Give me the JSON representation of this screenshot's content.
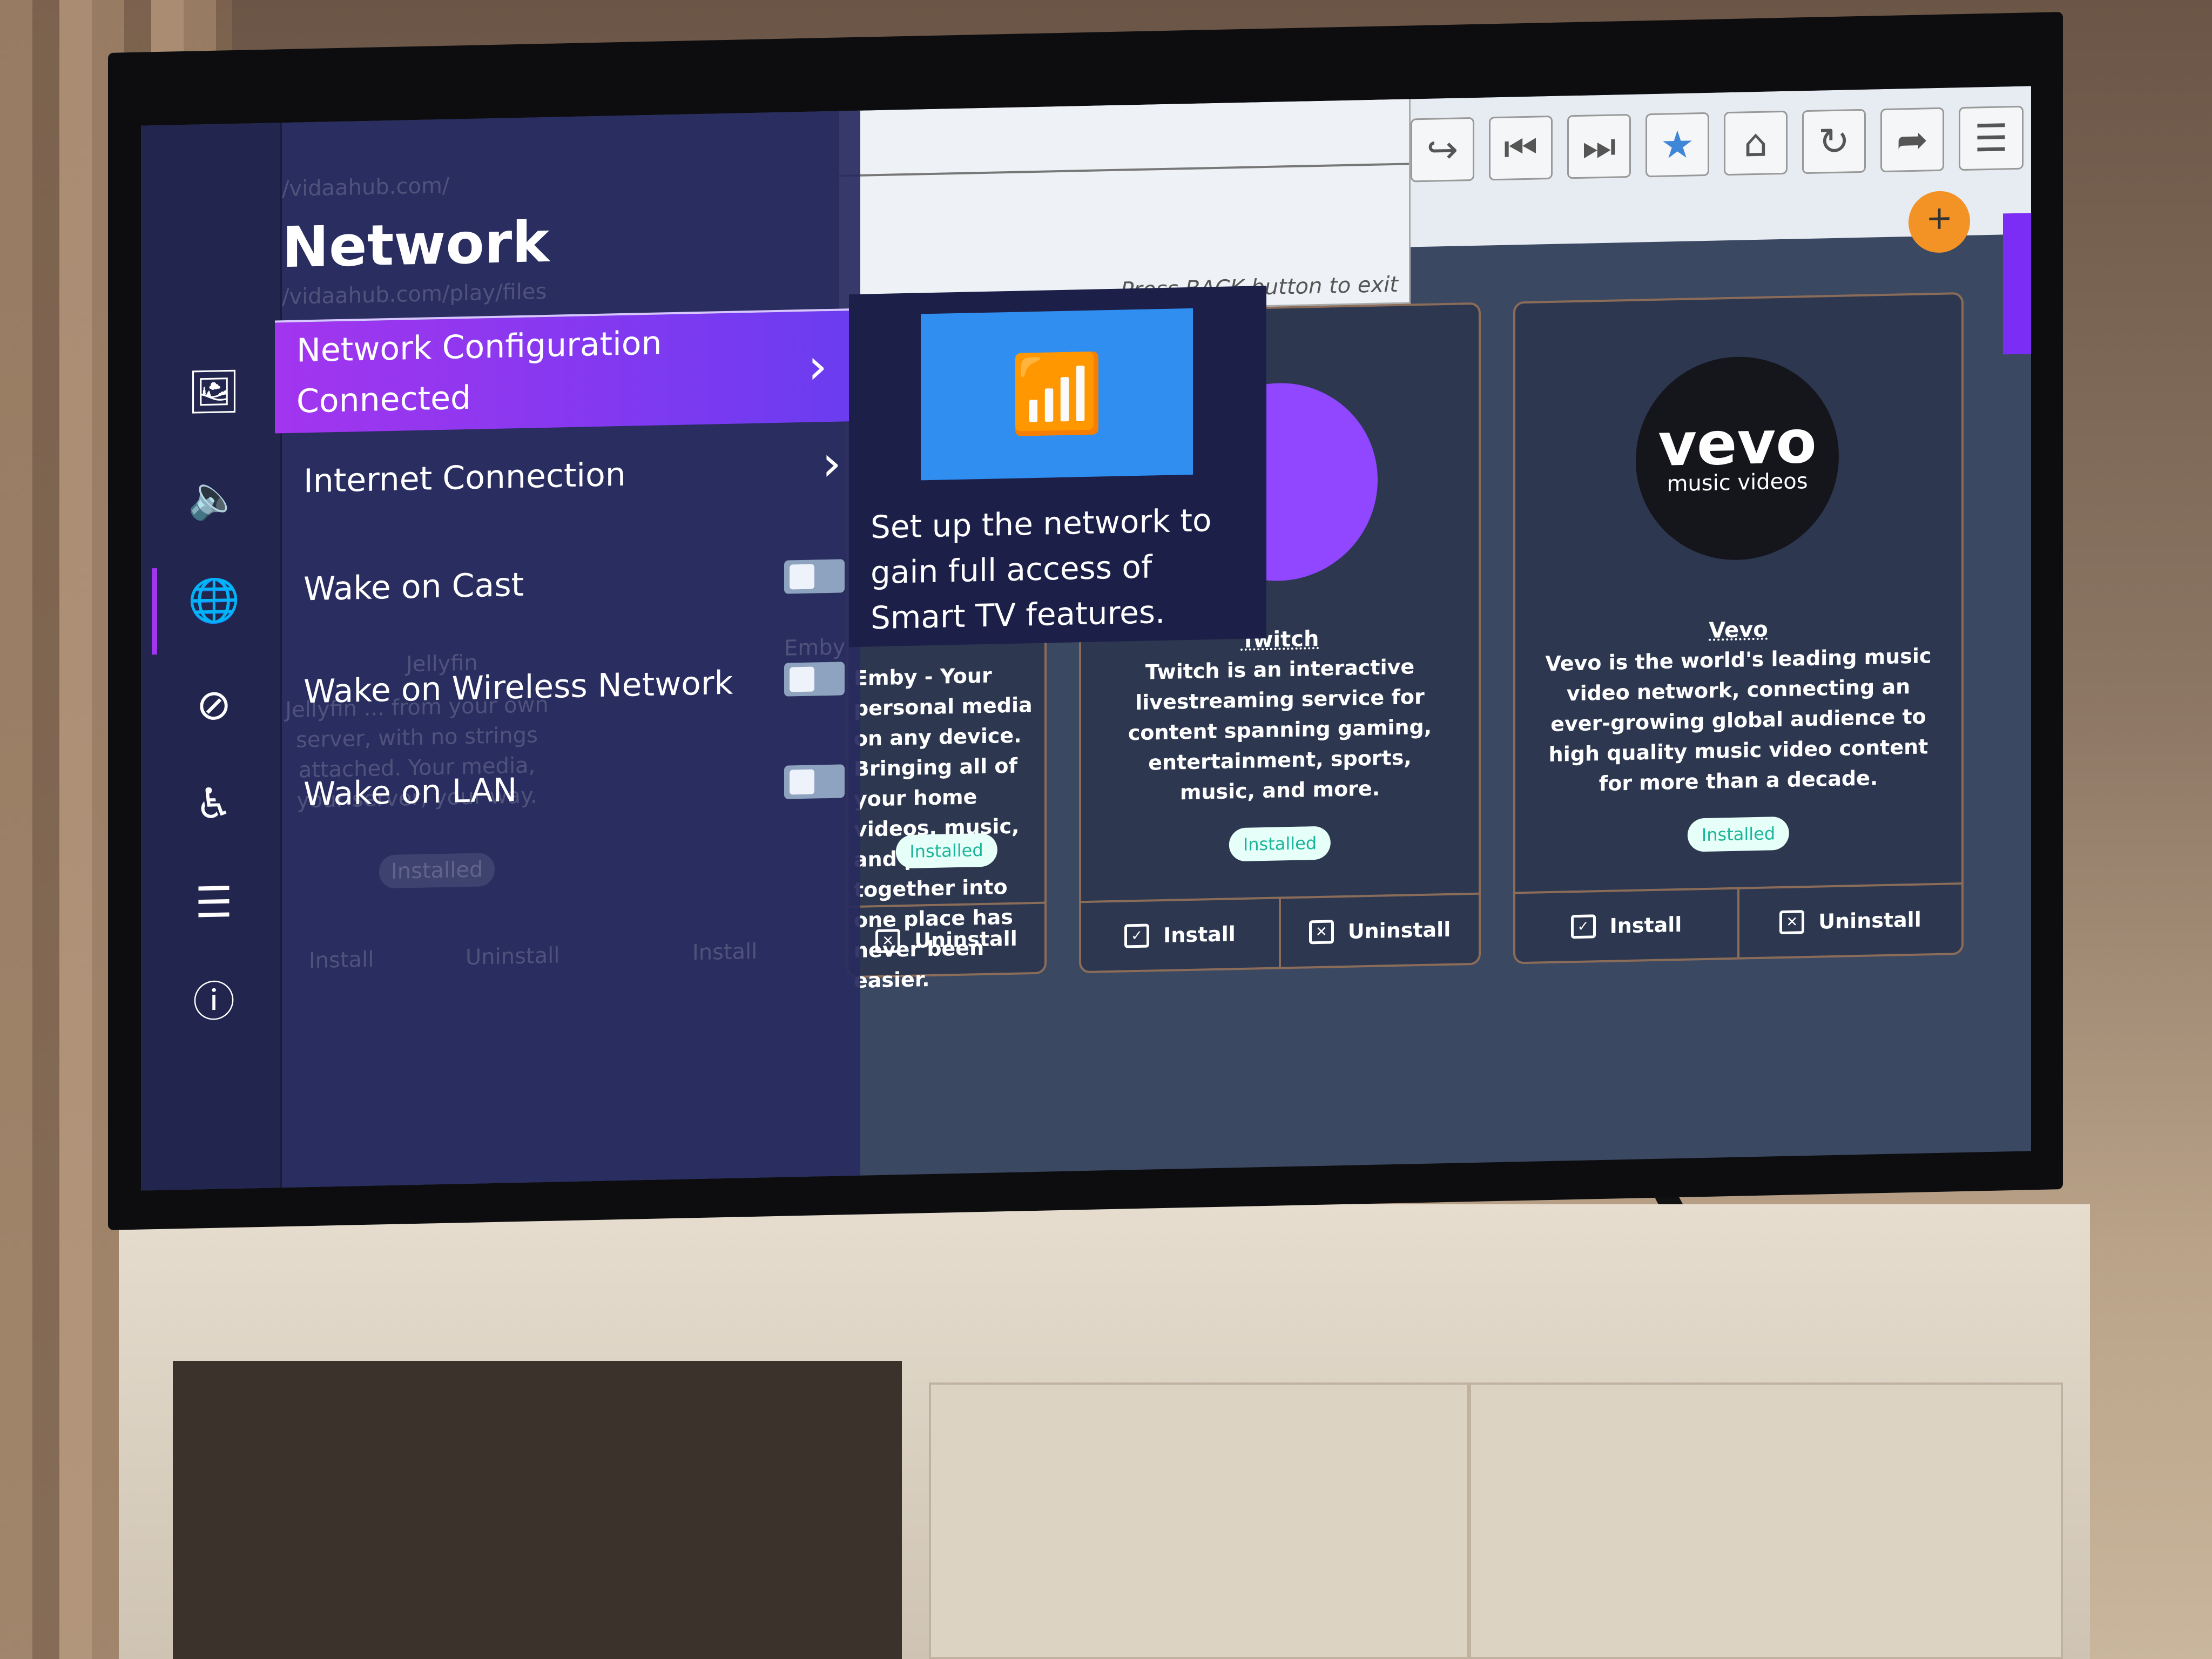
{
  "browser": {
    "toolbar_icons": [
      "redo-icon",
      "skip-back-icon",
      "skip-forward-icon",
      "star-icon",
      "home-icon",
      "reload-icon",
      "share-icon",
      "menu-icon"
    ],
    "star_color": "#3d86d8",
    "exit_hint": "Press BACK button to exit"
  },
  "background_page": {
    "url_1": "/vidaahub.com/",
    "url_2": "/vidaahub.com/play/files",
    "jellyfin": {
      "title": "Jellyfin",
      "desc": "Jellyfin ... from your own server, with no strings attached. Your media, your server, your way.",
      "status": "Installed"
    },
    "emby": {
      "title": "Emby",
      "desc": "Emby - Your personal media on any device. Bringing all of your home videos, music, and photos together into one place has never been easier.",
      "status": "Installed"
    },
    "twitch": {
      "title": "Twitch",
      "desc": "Twitch is an interactive livestreaming service for content spanning gaming, entertainment, sports, music, and more.",
      "status": "Installed"
    },
    "vevo": {
      "title": "Vevo",
      "logo_main": "vevo",
      "logo_sub": "music videos",
      "desc": "Vevo is the world's leading music video network, connecting an ever-growing global audience to high quality music video content for more than a decade.",
      "status": "Installed"
    },
    "install_label": "Install",
    "uninstall_label": "Uninstall"
  },
  "settings": {
    "rail_icons": [
      "picture-icon",
      "sound-icon",
      "network-globe-icon",
      "no-signal-icon",
      "accessibility-icon",
      "list-icon",
      "info-icon"
    ],
    "active_rail_index": 2,
    "title": "Network",
    "items": [
      {
        "label": "Network Configuration",
        "sub": "Connected"
      },
      {
        "label": "Internet Connection"
      },
      {
        "label": "Wake on Cast",
        "toggle": false
      },
      {
        "label": "Wake on Wireless Network",
        "toggle": false
      },
      {
        "label": "Wake on LAN",
        "toggle": false
      }
    ],
    "tooltip": "Set up the network to gain full access of Smart TV features.",
    "accent": "#a335ef"
  }
}
